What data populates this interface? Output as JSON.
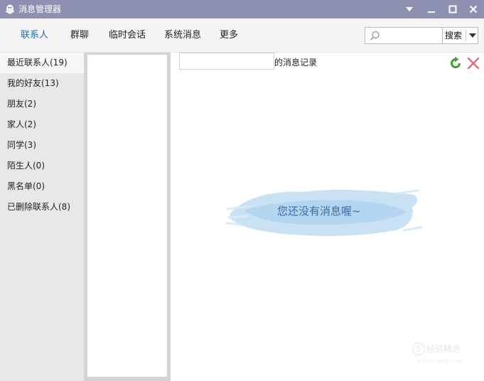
{
  "window": {
    "title": "消息管理器",
    "controls": [
      "chevron-down-icon",
      "minimize-icon",
      "maximize-icon",
      "close-icon"
    ]
  },
  "tabs": [
    {
      "label": "联系人",
      "active": true
    },
    {
      "label": "群聊"
    },
    {
      "label": "临时会话"
    },
    {
      "label": "系统消息"
    },
    {
      "label": "更多"
    }
  ],
  "search": {
    "value": "",
    "placeholder": "",
    "button_label": "搜索"
  },
  "sidebar": {
    "items": [
      {
        "label": "最近联系人(19)",
        "active": true
      },
      {
        "label": "我的好友(13)"
      },
      {
        "label": "朋友(2)"
      },
      {
        "label": "家人(2)"
      },
      {
        "label": "同学(3)"
      },
      {
        "label": "陌生人(0)"
      },
      {
        "label": "黑名单(0)"
      },
      {
        "label": "已删除联系人(8)"
      }
    ]
  },
  "main": {
    "contact_name": "",
    "record_suffix": "的消息记录",
    "empty_message": "您还没有消息喔~"
  },
  "watermark": {
    "text": "经验精选",
    "mark": "S",
    "url": "jingyan.baidu.com"
  },
  "colors": {
    "titlebar": "#8e90b2",
    "accent": "#1a6fb8",
    "sidebar_bg": "#e8e8ea",
    "refresh_green": "#3aa12c",
    "delete_red": "#e07070"
  }
}
